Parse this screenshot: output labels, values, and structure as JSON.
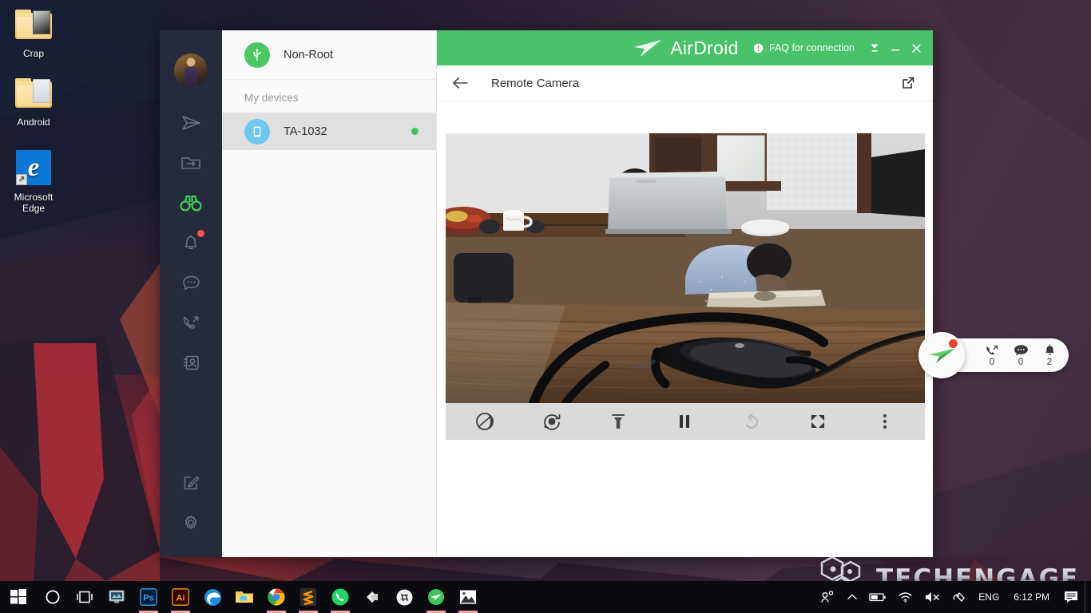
{
  "desktop": {
    "icons": [
      {
        "label": "Crap",
        "type": "folder-photo"
      },
      {
        "label": "Android",
        "type": "folder"
      },
      {
        "label": "Microsoft\nEdge",
        "label_line1": "Microsoft",
        "label_line2": "Edge",
        "type": "edge-shortcut"
      }
    ],
    "watermark": "TECHENGAGE"
  },
  "window": {
    "brand": "AirDroid",
    "faq_label": "FAQ for connection",
    "controls": {
      "collapse": "collapse-icon",
      "minimize": "–",
      "close": "✕"
    },
    "accent_green": "#4ac26a",
    "rail": {
      "avatar": "user-avatar",
      "items": [
        {
          "name": "send-icon",
          "active": false,
          "badge": false
        },
        {
          "name": "file-transfer-icon",
          "active": false,
          "badge": false
        },
        {
          "name": "binoculars-icon",
          "active": true,
          "badge": false
        },
        {
          "name": "bell-icon",
          "active": false,
          "badge": true
        },
        {
          "name": "chat-icon",
          "active": false,
          "badge": false
        },
        {
          "name": "call-icon",
          "active": false,
          "badge": false
        },
        {
          "name": "contacts-icon",
          "active": false,
          "badge": false
        }
      ],
      "bottom_items": [
        {
          "name": "compose-icon"
        },
        {
          "name": "settings-gear-icon"
        }
      ]
    },
    "devices": {
      "account_name": "Non-Root",
      "section_label": "My devices",
      "list": [
        {
          "name": "TA-1032",
          "status": "online",
          "selected": true
        }
      ]
    },
    "content": {
      "title": "Remote Camera",
      "back": "back-arrow",
      "popout": "open-in-new-window",
      "camera_tools": [
        {
          "name": "switch-lens-icon",
          "disabled": false
        },
        {
          "name": "flip-camera-icon",
          "disabled": false
        },
        {
          "name": "flashlight-icon",
          "disabled": false
        },
        {
          "name": "pause-icon",
          "disabled": false
        },
        {
          "name": "rotate-icon",
          "disabled": true
        },
        {
          "name": "fullscreen-icon",
          "disabled": false
        },
        {
          "name": "more-options-icon",
          "disabled": false
        }
      ]
    }
  },
  "float_widget": {
    "logo": "airdroid-logo",
    "items": [
      {
        "icon": "call-icon",
        "count": "0"
      },
      {
        "icon": "chat-icon",
        "count": "0"
      },
      {
        "icon": "bell-icon",
        "count": "2"
      }
    ]
  },
  "taskbar": {
    "pinned": [
      {
        "name": "start-button"
      },
      {
        "name": "cortana-search-icon"
      },
      {
        "name": "task-view-icon"
      },
      {
        "name": "monitor-app-icon"
      },
      {
        "name": "photoshop-icon",
        "label": "Ps",
        "running": true
      },
      {
        "name": "illustrator-icon",
        "label": "Ai",
        "running": true
      },
      {
        "name": "edge-icon"
      },
      {
        "name": "file-explorer-icon"
      },
      {
        "name": "chrome-icon",
        "running": true
      },
      {
        "name": "sublime-text-icon",
        "running": true
      },
      {
        "name": "whatsapp-icon",
        "running": true
      },
      {
        "name": "unity-icon"
      },
      {
        "name": "discord-icon"
      },
      {
        "name": "airdroid-icon",
        "running": true
      },
      {
        "name": "photos-icon",
        "running": true
      }
    ],
    "tray": [
      {
        "name": "people-icon"
      },
      {
        "name": "show-hidden-icons-chevron"
      },
      {
        "name": "battery-icon"
      },
      {
        "name": "wifi-icon"
      },
      {
        "name": "volume-muted-icon"
      },
      {
        "name": "pen-icon"
      }
    ],
    "language": "ENG",
    "time": "6:12 PM",
    "action_center": "action-center-icon"
  }
}
